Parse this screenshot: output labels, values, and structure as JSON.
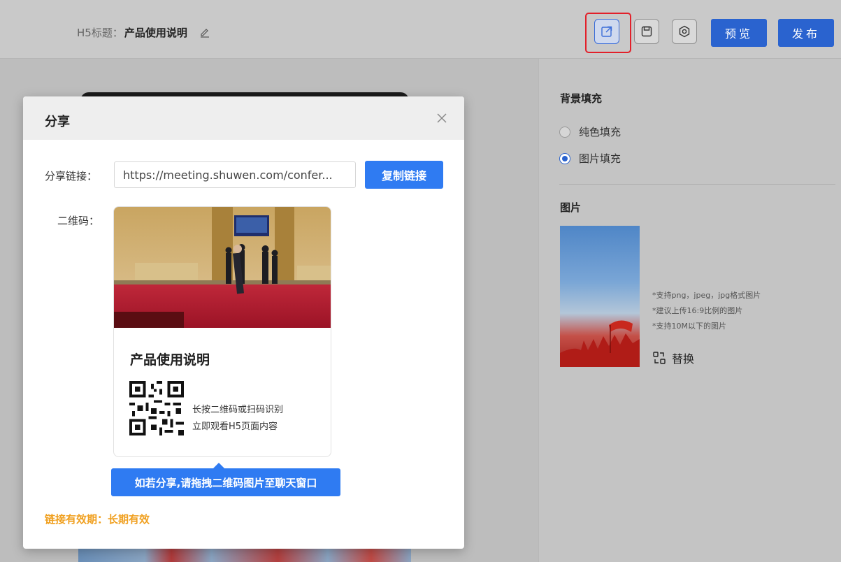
{
  "header": {
    "title_label": "H5标题：",
    "title_value": "产品使用说明",
    "preview_label": "预览",
    "publish_label": "发布",
    "colors": {
      "primary": "#2a63cf",
      "highlight": "#e2202a"
    }
  },
  "right_panel": {
    "bg_fill_title": "背景填充",
    "options": [
      "纯色填充",
      "图片填充"
    ],
    "selected_option": "图片填充",
    "image_title": "图片",
    "hints": [
      "*支持png，jpeg，jpg格式图片",
      "*建议上传16:9比例的图片",
      "*支持10M以下的图片"
    ],
    "replace_label": "替换"
  },
  "modal": {
    "title": "分享",
    "link_label": "分享链接：",
    "link_value": "https://meeting.shuwen.com/confer...",
    "copy_label": "复制链接",
    "qr_label": "二维码：",
    "card_title": "产品使用说明",
    "qr_line1": "长按二维码或扫码识别",
    "qr_line2": "立即观看H5页面内容",
    "tooltip": "如若分享,请拖拽二维码图片至聊天窗口",
    "validity": "链接有效期：长期有效",
    "colors": {
      "accent": "#2f7bf2",
      "warning": "#f0a020"
    }
  }
}
